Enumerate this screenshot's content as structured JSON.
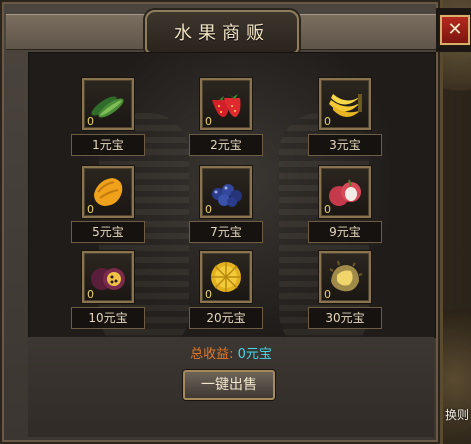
{
  "window": {
    "title": "水果商贩",
    "close_icon": "✕"
  },
  "items": [
    {
      "name": "cucumber-slot",
      "icon": "cucumber-icon",
      "count": "0",
      "price": "1元宝"
    },
    {
      "name": "strawberry-slot",
      "icon": "strawberry-icon",
      "count": "0",
      "price": "2元宝"
    },
    {
      "name": "banana-slot",
      "icon": "banana-icon",
      "count": "0",
      "price": "3元宝"
    },
    {
      "name": "mango-slot",
      "icon": "mango-icon",
      "count": "0",
      "price": "5元宝"
    },
    {
      "name": "blueberry-slot",
      "icon": "blueberry-icon",
      "count": "0",
      "price": "7元宝"
    },
    {
      "name": "lychee-slot",
      "icon": "lychee-icon",
      "count": "0",
      "price": "9元宝"
    },
    {
      "name": "passionfruit-slot",
      "icon": "passionfruit-icon",
      "count": "0",
      "price": "10元宝"
    },
    {
      "name": "jackfruit-slot",
      "icon": "jackfruit-icon",
      "count": "0",
      "price": "20元宝"
    },
    {
      "name": "durian-slot",
      "icon": "durian-icon",
      "count": "0",
      "price": "30元宝"
    }
  ],
  "earnings": {
    "label": "总收益:",
    "value": "0元宝"
  },
  "sell_all_label": "一键出售",
  "corner_text": "换则"
}
